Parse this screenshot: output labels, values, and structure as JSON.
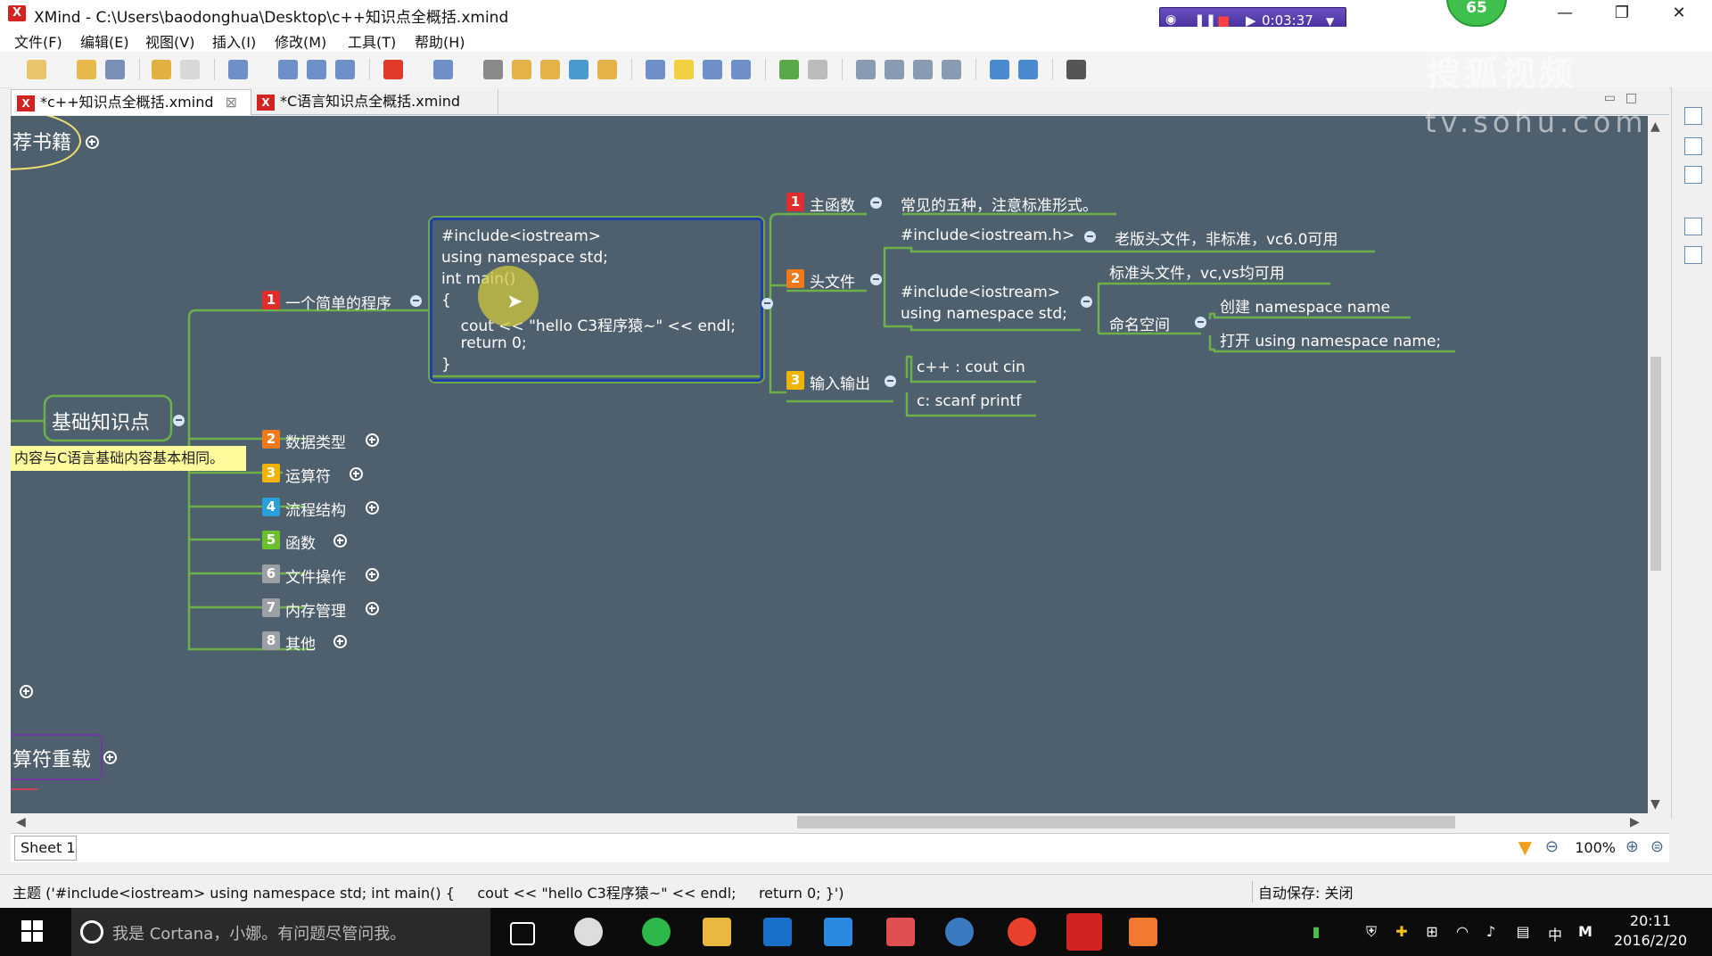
{
  "window": {
    "title": "XMind - C:\\Users\\baodonghua\\Desktop\\c++知识点全概括.xmind",
    "recorder_time": "0:03:37",
    "badge": "65"
  },
  "menu": [
    "文件(F)",
    "编辑(E)",
    "视图(V)",
    "插入(I)",
    "修改(M)",
    "工具(T)",
    "帮助(H)"
  ],
  "tabs": [
    {
      "label": "*c++知识点全概括.xmind",
      "active": true
    },
    {
      "label": "*C语言知识点全概括.xmind",
      "active": false
    }
  ],
  "watermark": {
    "line1": "搜狐视频",
    "line2": "tv.sohu.com"
  },
  "mindmap": {
    "partial_top": "荐书籍",
    "central": "基础知识点",
    "partial_bottom": "算符重载",
    "note": "内容与C语言基础内容基本相同。",
    "branches": [
      {
        "n": "1",
        "label": "一个简单的程序",
        "color": "#e02d2d"
      },
      {
        "n": "2",
        "label": "数据类型",
        "color": "#f07a1a"
      },
      {
        "n": "3",
        "label": "运算符",
        "color": "#f0b400"
      },
      {
        "n": "4",
        "label": "流程结构",
        "color": "#2aa0d8"
      },
      {
        "n": "5",
        "label": "函数",
        "color": "#6cc02e"
      },
      {
        "n": "6",
        "label": "文件操作",
        "color": "#9aa0a6"
      },
      {
        "n": "7",
        "label": "内存管理",
        "color": "#9aa0a6"
      },
      {
        "n": "8",
        "label": "其他",
        "color": "#9aa0a6"
      }
    ],
    "code": [
      "#include<iostream>",
      "using namespace std;",
      "int main()",
      "{",
      "    cout << \"hello C3程序猿~\" << endl;",
      "    return 0;",
      "}"
    ],
    "subtopics": {
      "t1_n": "1",
      "t1": "主函数",
      "t1_note": "常见的五种，注意标准形式。",
      "t2_n": "2",
      "t2": "头文件",
      "t2_a": "#include<iostream.h>",
      "t2_a_note": "老版头文件，非标准，vc6.0可用",
      "t2_b1": "#include<iostream>",
      "t2_b2": "using namespace std;",
      "t2_b_note": "标准头文件，vc,vs均可用",
      "ns": "命名空间",
      "ns_a": "创建 namespace name",
      "ns_b": "打开 using namespace name;",
      "t3_n": "3",
      "t3": "输入输出",
      "t3_a": "c++ : cout cin",
      "t3_b": "c: scanf printf"
    }
  },
  "sheet": {
    "tab": "Sheet 1",
    "zoom": "100%"
  },
  "status": {
    "topic": "主题 ('#include<iostream> using namespace std; int main() {     cout << \"hello C3程序猿~\" << endl;     return 0; }')",
    "autosave": "自动保存: 关闭"
  },
  "taskbar": {
    "cortana": "我是 Cortana，小娜。有问题尽管问我。",
    "time": "20:11",
    "date": "2016/2/20",
    "ime": "中",
    "ime2": "M"
  }
}
